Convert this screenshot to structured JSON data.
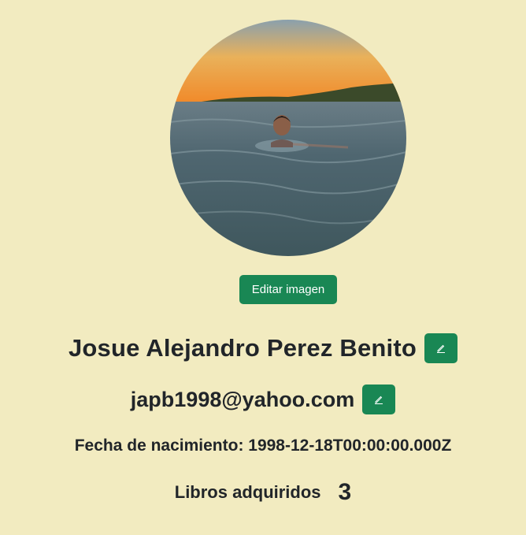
{
  "profile": {
    "edit_image_label": "Editar imagen",
    "name": "Josue Alejandro Perez Benito",
    "email": "japb1998@yahoo.com",
    "birth_date_label": "Fecha de nacimiento: 1998-12-18T00:00:00.000Z",
    "books_label": "Libros adquiridos",
    "books_count": "3"
  },
  "icons": {
    "edit_name": "pencil-icon",
    "edit_email": "pencil-icon"
  },
  "colors": {
    "background": "#f2ebc0",
    "accent": "#198754",
    "text": "#212529"
  }
}
